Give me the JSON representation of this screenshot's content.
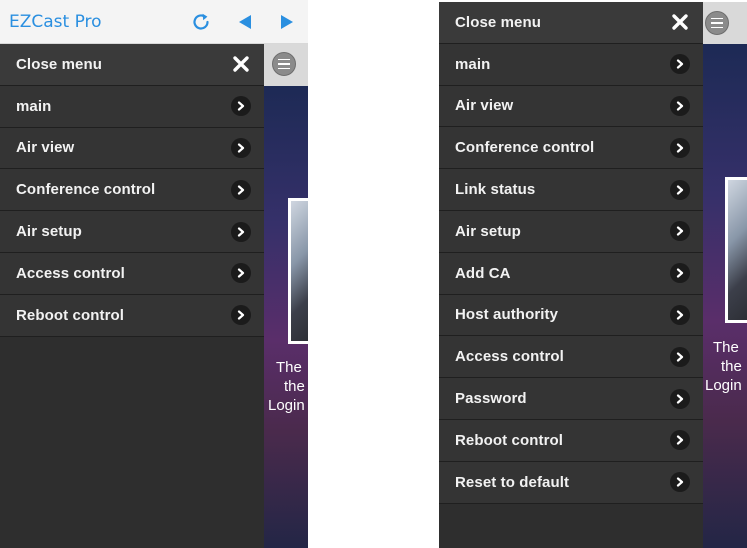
{
  "app": {
    "title": "EZCast Pro"
  },
  "left_menu": {
    "items": [
      {
        "label": "Close menu",
        "icon": "close-icon"
      },
      {
        "label": "main",
        "icon": "chevron-right-icon"
      },
      {
        "label": "Air view",
        "icon": "chevron-right-icon"
      },
      {
        "label": "Conference control",
        "icon": "chevron-right-icon"
      },
      {
        "label": "Air setup",
        "icon": "chevron-right-icon"
      },
      {
        "label": "Access control",
        "icon": "chevron-right-icon"
      },
      {
        "label": "Reboot control",
        "icon": "chevron-right-icon"
      }
    ]
  },
  "right_menu": {
    "items": [
      {
        "label": "Close menu",
        "icon": "close-icon"
      },
      {
        "label": "main",
        "icon": "chevron-right-icon"
      },
      {
        "label": "Air view",
        "icon": "chevron-right-icon"
      },
      {
        "label": "Conference control",
        "icon": "chevron-right-icon"
      },
      {
        "label": "Link status",
        "icon": "chevron-right-icon"
      },
      {
        "label": "Air setup",
        "icon": "chevron-right-icon"
      },
      {
        "label": "Add CA",
        "icon": "chevron-right-icon"
      },
      {
        "label": "Host authority",
        "icon": "chevron-right-icon"
      },
      {
        "label": "Access control",
        "icon": "chevron-right-icon"
      },
      {
        "label": "Password",
        "icon": "chevron-right-icon"
      },
      {
        "label": "Reboot control",
        "icon": "chevron-right-icon"
      },
      {
        "label": "Reset to default",
        "icon": "chevron-right-icon"
      }
    ]
  },
  "left_peek": {
    "line1": "The",
    "line2": "the",
    "line3": "Login"
  },
  "right_peek": {
    "line1": "The",
    "line2": "the",
    "line3": "Login"
  },
  "colors": {
    "accent": "#2a8fe0",
    "menu_bg": "#343434",
    "menu_text": "#f2f2f2"
  }
}
